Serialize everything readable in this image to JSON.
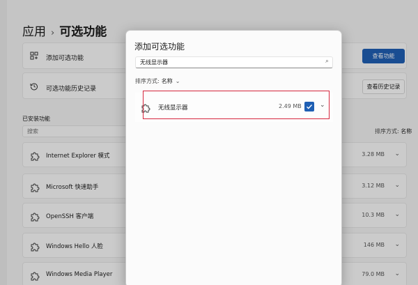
{
  "breadcrumb": {
    "parent": "应用",
    "separator": "›",
    "current": "可选功能"
  },
  "rows": {
    "add": {
      "label": "添加可选功能",
      "icon": "add-grid-icon",
      "button": "查看功能"
    },
    "history": {
      "label": "可选功能历史记录",
      "icon": "history-icon",
      "button": "查看历史记录"
    }
  },
  "installed": {
    "title": "已安装功能",
    "search_placeholder": "搜索",
    "sort_label": "排序方式:",
    "sort_value": "名称",
    "items": [
      {
        "name": "Internet Explorer 模式",
        "size": "3.28 MB"
      },
      {
        "name": "Microsoft 快速助手",
        "size": "3.12 MB"
      },
      {
        "name": "OpenSSH 客户端",
        "size": "10.3 MB"
      },
      {
        "name": "Windows Hello 人脸",
        "size": "146 MB"
      },
      {
        "name": "Windows Media Player",
        "size": "79.0 MB"
      }
    ]
  },
  "dialog": {
    "title": "添加可选功能",
    "search_value": "无线显示器",
    "sort_label": "排序方式:",
    "sort_value": "名称",
    "result": {
      "name": "无线显示器",
      "size": "2.49 MB",
      "checked": true
    }
  },
  "colors": {
    "accent": "#1f5fb4",
    "highlight": "#d6253d"
  }
}
